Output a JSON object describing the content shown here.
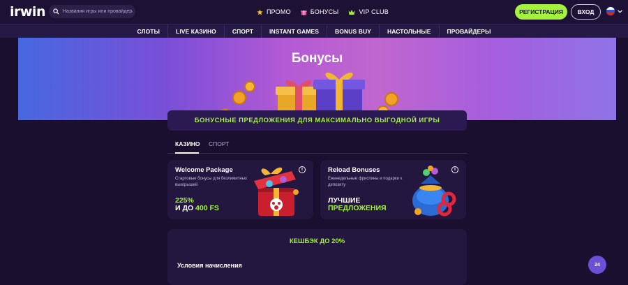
{
  "header": {
    "logo_text": "irwin",
    "search_placeholder": "Названия игры или провайдера",
    "nav": [
      {
        "label": "ПРОМО",
        "icon": "star-icon",
        "color": "#f5c531"
      },
      {
        "label": "БОНУСЫ",
        "icon": "gift-icon",
        "color": "#e8559b"
      },
      {
        "label": "VIP CLUB",
        "icon": "crown-icon",
        "color": "#a4f23b"
      }
    ],
    "register_label": "РЕГИСТРАЦИЯ",
    "login_label": "ВХОД",
    "language_icon": "russia-flag-icon"
  },
  "categories": [
    "СЛОТЫ",
    "LIVE КАЗИНО",
    "СПОРТ",
    "INSTANT GAMES",
    "BONUS BUY",
    "НАСТОЛЬНЫЕ",
    "ПРОВАЙДЕРЫ"
  ],
  "hero": {
    "title": "Бонусы"
  },
  "banner": {
    "text": "БОНУСНЫЕ ПРЕДЛОЖЕНИЯ ДЛЯ МАКСИМАЛЬНО ВЫГОДНОЙ ИГРЫ"
  },
  "tabs": [
    {
      "label": "КАЗИНО",
      "active": true
    },
    {
      "label": "СПОРТ",
      "active": false
    }
  ],
  "cards": [
    {
      "title": "Welcome Package",
      "description": "Стартовые бонусы для безлимитных выигрышей",
      "line1_value": "225%",
      "line2_prefix": "И ДО",
      "line2_value": "400 FS"
    },
    {
      "title": "Reload Bonuses",
      "description": "Еженедельные фриспины и подарки к депозиту",
      "line1": "ЛУЧШИЕ",
      "line2": "ПРЕДЛОЖЕНИЯ"
    }
  ],
  "cashback": {
    "title": "КЕШБЭК ДО 20%",
    "conditions_title": "Условия начисления"
  },
  "support": {
    "label": "24"
  },
  "colors": {
    "accent": "#a4f23b",
    "background": "#1a0f2e",
    "card": "#23163f"
  }
}
